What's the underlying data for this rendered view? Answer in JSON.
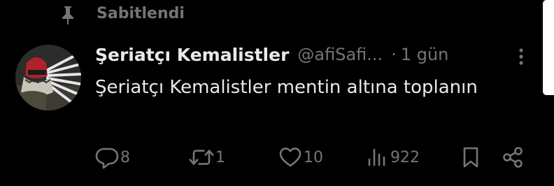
{
  "pinned": {
    "label": "Sabitlendi",
    "icon": "pin-icon"
  },
  "tweet": {
    "author": {
      "display_name": "Şeriatçı Kemalistler",
      "handle": "@afiSafi...",
      "avatar_icon": "avatar-image"
    },
    "separator": "·",
    "time": "1 gün",
    "text": "Şeriatçı Kemalistler mentin altına toplanın",
    "actions": {
      "replies": {
        "icon": "reply-icon",
        "count": "8"
      },
      "reposts": {
        "icon": "repost-icon",
        "count": "1"
      },
      "likes": {
        "icon": "like-icon",
        "count": "10"
      },
      "views": {
        "icon": "views-icon",
        "count": "922"
      },
      "bookmark": {
        "icon": "bookmark-icon"
      },
      "share": {
        "icon": "share-icon"
      }
    }
  },
  "colors": {
    "background": "#000000",
    "primary_text": "#e7e9ea",
    "secondary_text": "#71767b"
  }
}
